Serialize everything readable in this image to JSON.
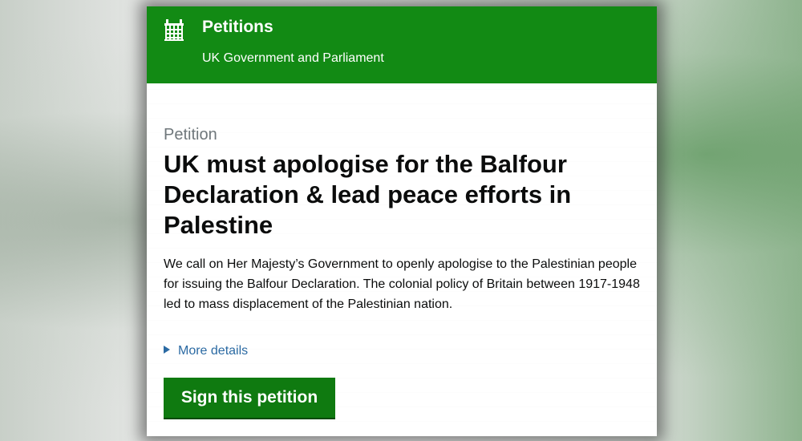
{
  "header": {
    "logo_icon": "portcullis-icon",
    "title": "Petitions",
    "subtitle": "UK Government and Parliament"
  },
  "petition": {
    "label": "Petition",
    "title": "UK must apologise for the Balfour Declaration & lead peace efforts in Palestine",
    "description": "We call on Her Majesty’s Government to openly apologise to the Palestinian people for issuing the Balfour Declaration. The colonial policy of Britain between 1917-1948 led to mass displacement of the Palestinian nation.",
    "details_label": "More details",
    "details_icon": "triangle-right-icon",
    "sign_button_label": "Sign this petition"
  },
  "colors": {
    "brand_green": "#128a14",
    "button_green": "#0f7a10",
    "link_blue": "#2b6aa3",
    "text": "#0b0c0c",
    "secondary_text": "#6f777b"
  }
}
